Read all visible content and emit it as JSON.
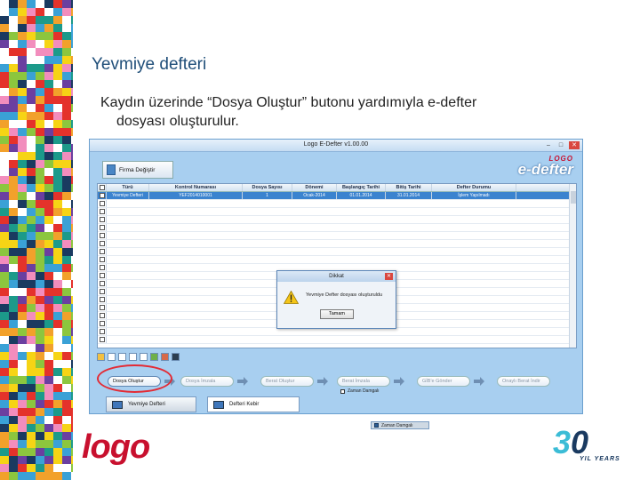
{
  "slide": {
    "title": "Yevmiye defteri",
    "body_line1": "Kaydın üzerinde “Dosya Oluştur” butonu yardımıyla e-defter",
    "body_line2": "dosyası oluşturulur."
  },
  "window": {
    "title": "Logo E-Defter v1.00.00",
    "controls": [
      "–",
      "□",
      "✕"
    ],
    "firma_button": "Firma Değiştir",
    "logo_small": "LOGO",
    "logo_big": "e-defter"
  },
  "grid": {
    "headers": [
      "Türü",
      "Kontrol Numarası",
      "Dosya Sayısı",
      "Dönemi",
      "Başlangıç Tarihi",
      "Bitiş Tarihi",
      "Defter Durumu"
    ],
    "rows": [
      [
        "Yevmiye Defteri",
        "YEF2014010001",
        "1",
        "Ocak-2014",
        "01.01.2014",
        "31.01.2014",
        "İşlem Yapılmadı"
      ]
    ]
  },
  "dialog": {
    "title": "Dikkat",
    "message": "Yevmiye Defter dosyası oluşturuldu",
    "ok": "Tamam"
  },
  "steps": {
    "items": [
      "Dosya Oluştur",
      "Dosya İmzala",
      "Berat Oluştur",
      "Berat İmzala",
      "GİB'e Gönder",
      "Onaylı Berat İndir"
    ],
    "zaman_damgali": "Zaman Damgalı"
  },
  "tabs": {
    "tab1": "Yevmiye Defteri",
    "tab2": "Defteri Kebir"
  },
  "outside": {
    "zaman_tag": "Zaman Damgalı",
    "brand": "logo",
    "anniv_num_a": "3",
    "anniv_num_b": "0",
    "anniv_tag": "YIL YEARS"
  },
  "colors": {
    "accent": "#1f4e79",
    "highlight": "#e32b35",
    "brand_red": "#c8102e",
    "selection": "#3b83cf"
  }
}
